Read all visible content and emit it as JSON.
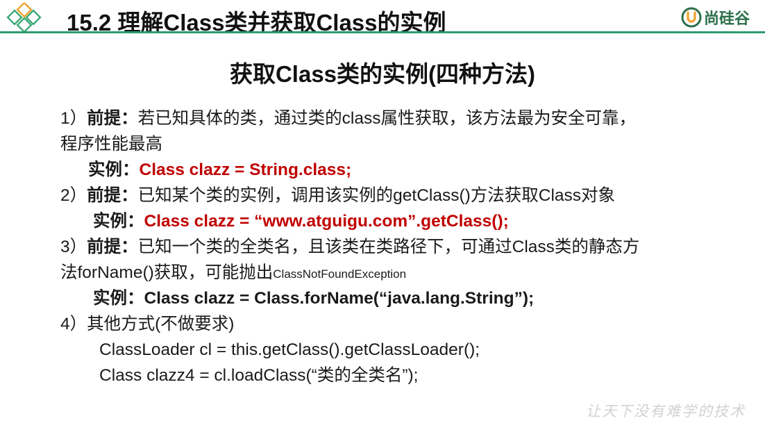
{
  "header": {
    "title": "15.2 理解Class类并获取Class的实例",
    "brand": "尚硅谷"
  },
  "subtitle": "获取Class类的实例(四种方法)",
  "items": {
    "m1": {
      "num": "1）",
      "label": "前提：",
      "text1": "若已知具体的类，通过类的class属性获取，该方法最为安全可靠，",
      "text2": "程序性能最高",
      "ex_label": "实例：",
      "ex_code": "Class clazz = String.class;"
    },
    "m2": {
      "num": "2）",
      "label": "前提：",
      "text": "已知某个类的实例，调用该实例的getClass()方法获取Class对象",
      "ex_label": "实例：",
      "ex_code": "Class clazz = “www.atguigu.com”.getClass();"
    },
    "m3": {
      "num": "3）",
      "label": "前提：",
      "text1": "已知一个类的全类名，且该类在类路径下，可通过Class类的静态方",
      "text2": "法forName()获取，可能抛出",
      "exception": "ClassNotFoundException",
      "ex_label": "实例：",
      "ex_code": "Class clazz = Class.forName(“java.lang.String”);"
    },
    "m4": {
      "num": "4）",
      "text": "其他方式(不做要求)",
      "code1": "ClassLoader cl = this.getClass().getClassLoader();",
      "code2": "Class clazz4 = cl.loadClass(“类的全类名”);"
    }
  },
  "footer": {
    "slogan": "让天下没有难学的技术"
  },
  "colors": {
    "accent": "#2f9c6e",
    "brand": "#2b6f4a",
    "highlight": "#c00000"
  }
}
